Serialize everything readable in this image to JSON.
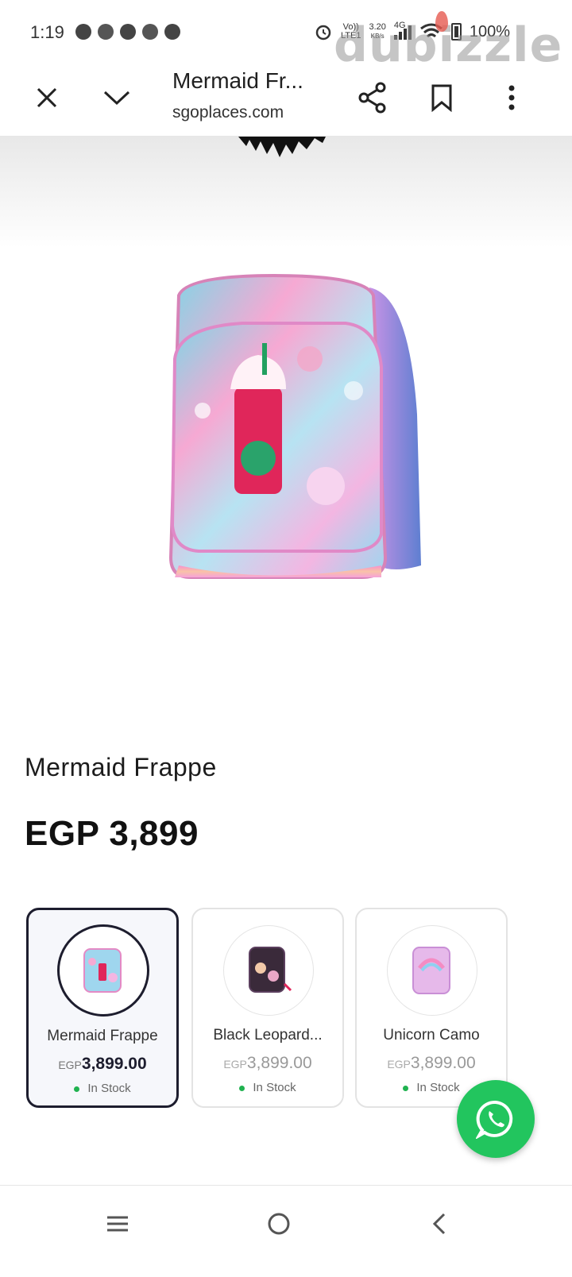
{
  "status_bar": {
    "time": "1:19",
    "network_left": "Vo))",
    "network_left_sub": "LTE1",
    "speed": "3.20",
    "speed_unit": "KB/s",
    "network_type": "4G",
    "battery": "100%"
  },
  "watermark": {
    "text": "dubizzle"
  },
  "toolbar": {
    "title": "Mermaid Fr...",
    "url": "sgoplaces.com",
    "icons": [
      "close-icon",
      "chevron-down-icon",
      "share-icon",
      "bookmark-icon",
      "more-vert-icon"
    ]
  },
  "product": {
    "name": "Mermaid Frappe",
    "price": "EGP 3,899"
  },
  "variants": [
    {
      "name": "Mermaid Frappe",
      "currency": "EGP",
      "amount": "3,899.00",
      "stock": "In Stock",
      "selected": true
    },
    {
      "name": "Black Leopard...",
      "currency": "EGP",
      "amount": "3,899.00",
      "stock": "In Stock",
      "selected": false
    },
    {
      "name": "Unicorn Camo",
      "currency": "EGP",
      "amount": "3,899.00",
      "stock": "In Stock",
      "selected": false
    }
  ],
  "floating": {
    "icon": "whatsapp-icon"
  },
  "nav_bar": {
    "icons": [
      "recents-icon",
      "home-icon",
      "back-icon"
    ]
  },
  "colors": {
    "accent": "#1d1d2e",
    "whatsapp": "#22c55e",
    "in_stock": "#20b250"
  }
}
